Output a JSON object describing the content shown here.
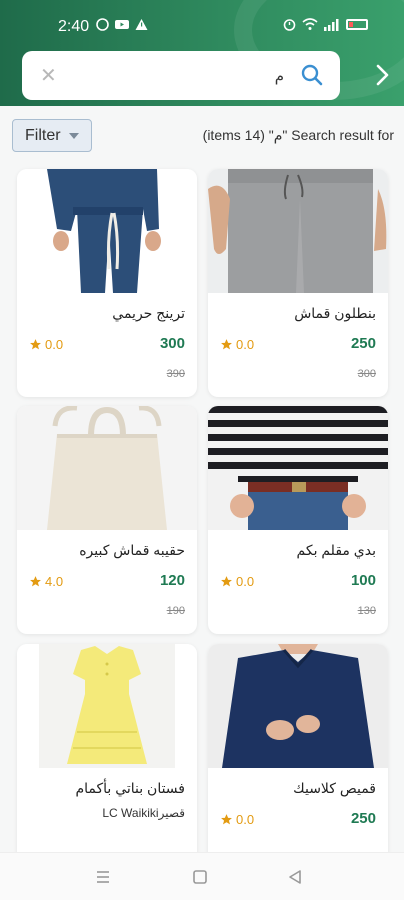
{
  "status_bar": {
    "time": "2:40",
    "left_icons": [
      "whatsapp-icon",
      "youtube-icon",
      "warning-icon"
    ],
    "right_icons": [
      "alarm-icon",
      "wifi-icon",
      "signal-icon",
      "battery-low-icon"
    ]
  },
  "search": {
    "query": "م",
    "clear_icon": "close-icon",
    "search_icon": "search-icon"
  },
  "header": {
    "next_icon": "chevron-right-icon",
    "colors": {
      "start": "#1f6b4a",
      "end": "#3aa06c"
    }
  },
  "filter": {
    "label": "Filter"
  },
  "results": {
    "summary": "(items 14) \"م\" Search result for"
  },
  "products": [
    {
      "name": "بنطلون قماش",
      "price": "250",
      "old_price": "300",
      "rating": "0.0"
    },
    {
      "name": "ترينج حريمي",
      "price": "300",
      "old_price": "390",
      "rating": "0.0"
    },
    {
      "name": "بدي مقلم بكم",
      "price": "100",
      "old_price": "130",
      "rating": "0.0"
    },
    {
      "name": "حقيبه قماش كبيره",
      "price": "120",
      "old_price": "190",
      "rating": "4.0"
    },
    {
      "name": "قميص كلاسيك",
      "price": "250",
      "old_price": "",
      "rating": "0.0"
    },
    {
      "name": "فستان بناتي  بأكمام",
      "subtitle": "قصيرLC Waikiki",
      "price": "",
      "old_price": "",
      "rating": ""
    }
  ],
  "colors": {
    "accent": "#1f7a53",
    "rating": "#e39b12"
  },
  "navbar": {
    "icons": [
      "menu-icon",
      "home-square-icon",
      "back-triangle-icon"
    ]
  }
}
